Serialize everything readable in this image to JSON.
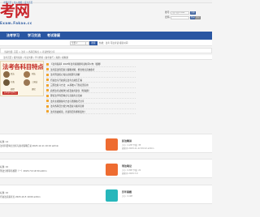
{
  "topbar": {
    "links": "考网首页 | 加入收藏 | 设为首页"
  },
  "logo": {
    "big": "考网",
    "sub": "Exam.Fakao.cc"
  },
  "login": {
    "username_label": "账号:",
    "username_placeholder": "用户名/Email",
    "register": "注册",
    "password_label": "密码:",
    "login": "登录",
    "forgot": "忘记"
  },
  "nav": {
    "items": [
      "法考学习",
      "学习交流",
      "考试答疑"
    ]
  },
  "search": {
    "select": "全部",
    "button": "搜索",
    "hot": "热搜：法考 司法考试 报名时间"
  },
  "breadcrumb": "当前位置: 首页 > 法考 > 各科目特点 > 考试经验分享",
  "subnav": "法考首页 | 报考指南 | 考试大纲 | 学习经验 | 备考技巧 | 真题 | 模拟题",
  "banner": {
    "title": "法考各科目特点",
    "names": [
      "民法",
      "刑法",
      "行政",
      "三国法",
      "商经",
      "理论"
    ],
    "pill": "法考各科目特点"
  },
  "news": [
    "【法考指南】2023年法考客观题考试时间公布（组图）",
    "法考民法科目复习策略详解，抓住重点高效备考",
    "法考刑法核心知识点梳理与讲解",
    "行政法与行政诉讼法考点总结汇编",
    "三国法复习方法：从基础入门到灵活应用",
    "商经法考试规律分析及备考建议（附真题）",
    "理论法学科目特点与高频考点归纳",
    "法考主观题备考方法与答题技巧分享",
    "法考各科目分值分布及复习顺序安排",
    "法考新政解读，考试科目有哪些变化？"
  ],
  "cards": [
    {
      "left1": "标题: 14",
      "left2": "法考科目特点分析与备考策略汇总 2023-12-11 10:10 admin",
      "title": "民法精讲",
      "meta": "大小: 1.2M 下载: 35",
      "meta2": "更新于 2023-11-12 09:12 admin",
      "color": "#ee6c31"
    },
    {
      "left1": "标题: 10",
      "left2": "刑法分则罪名梳理（一）2023-7-9 14:50 admin",
      "title": "刑法笔记",
      "meta": "大小: 0.8M 下载: 21",
      "meta2": "更新于 2023-7-9",
      "color": "#ee6c31"
    },
    {
      "left1": "标题: 10",
      "left2": "行政法高频考点 2023-10-5 10:00 admin",
      "title": "历年真题",
      "meta": "大小: 2.4M",
      "meta2": "",
      "color": "#27b7bb"
    }
  ],
  "colors": {
    "nav": "#2a56a2",
    "logo_red": "#c9242b",
    "accent_orange": "#ee6c31",
    "accent_teal": "#27b7bb"
  }
}
